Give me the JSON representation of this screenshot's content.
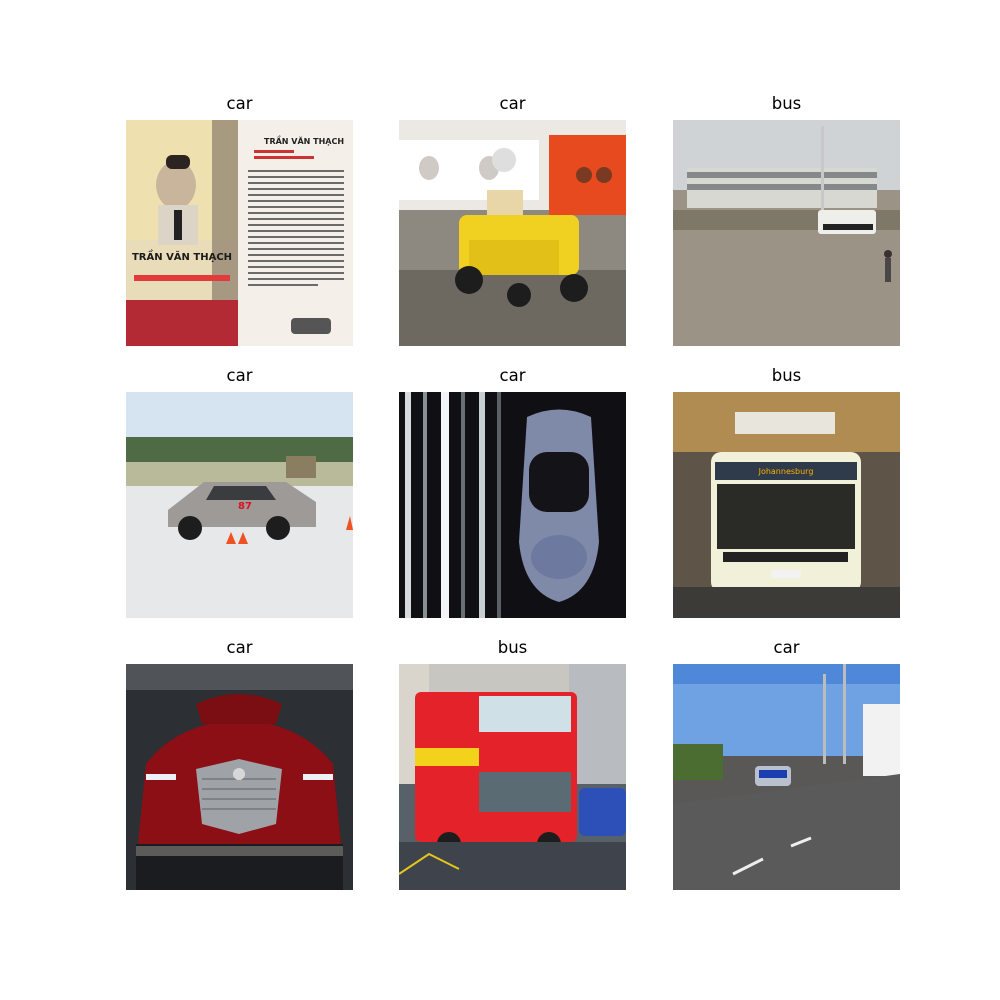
{
  "grid": [
    {
      "label": "car",
      "cover_title": "TRẦN VĂN THẠCH",
      "cover_heading": "TRẦN VĂN THẠCH"
    },
    {
      "label": "car"
    },
    {
      "label": "bus"
    },
    {
      "label": "car",
      "race_number": "87"
    },
    {
      "label": "car"
    },
    {
      "label": "bus",
      "destination": "Johannesburg"
    },
    {
      "label": "car"
    },
    {
      "label": "bus"
    },
    {
      "label": "car"
    }
  ]
}
